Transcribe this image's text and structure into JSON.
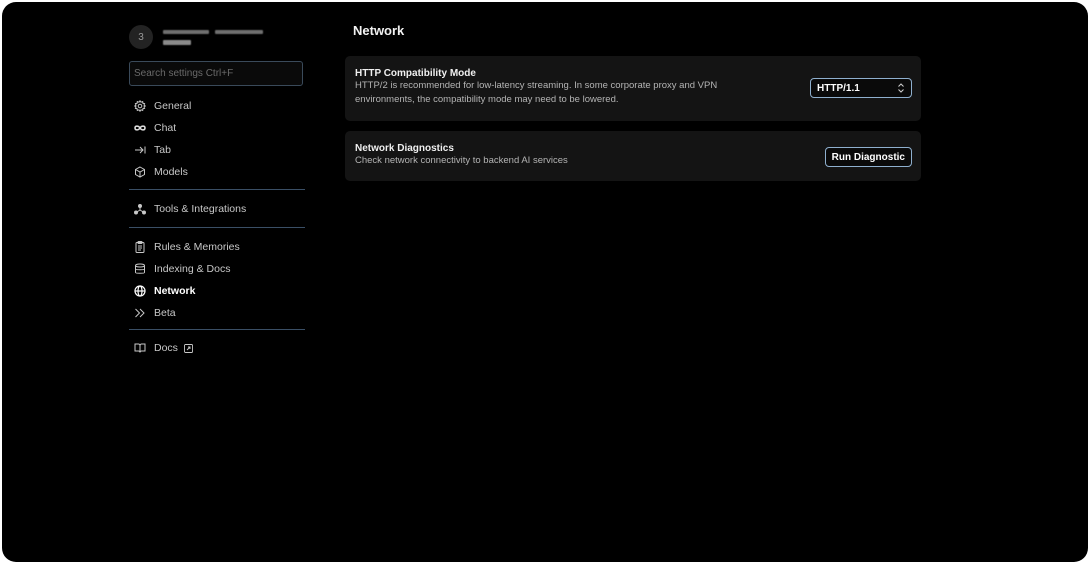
{
  "account": {
    "avatar_initial": "3"
  },
  "search": {
    "placeholder": "Search settings Ctrl+F"
  },
  "sidebar": {
    "group1": [
      {
        "label": "General",
        "icon": "gear-icon"
      },
      {
        "label": "Chat",
        "icon": "infinity-icon"
      },
      {
        "label": "Tab",
        "icon": "tab-arrow-icon"
      },
      {
        "label": "Models",
        "icon": "cube-icon"
      }
    ],
    "group2": [
      {
        "label": "Tools & Integrations",
        "icon": "network-nodes-icon"
      }
    ],
    "group3": [
      {
        "label": "Rules & Memories",
        "icon": "clipboard-icon"
      },
      {
        "label": "Indexing & Docs",
        "icon": "database-icon"
      },
      {
        "label": "Network",
        "icon": "globe-icon",
        "active": true
      },
      {
        "label": "Beta",
        "icon": "double-chevron-icon"
      }
    ],
    "group4": [
      {
        "label": "Docs",
        "icon": "book-icon",
        "external": true
      }
    ]
  },
  "main": {
    "title": "Network",
    "http_card": {
      "title": "HTTP Compatibility Mode",
      "desc_line1": "HTTP/2 is recommended for low-latency streaming. In some corporate proxy and VPN",
      "desc_line2": "environments, the compatibility mode may need to be lowered.",
      "selected_value": "HTTP/1.1"
    },
    "diag_card": {
      "title": "Network Diagnostics",
      "desc": "Check network connectivity to backend AI services",
      "button_label": "Run Diagnostic"
    }
  },
  "colors": {
    "background": "#000000",
    "card": "#141414",
    "divider": "#3a4f66",
    "control_border": "#8fb0cf"
  }
}
